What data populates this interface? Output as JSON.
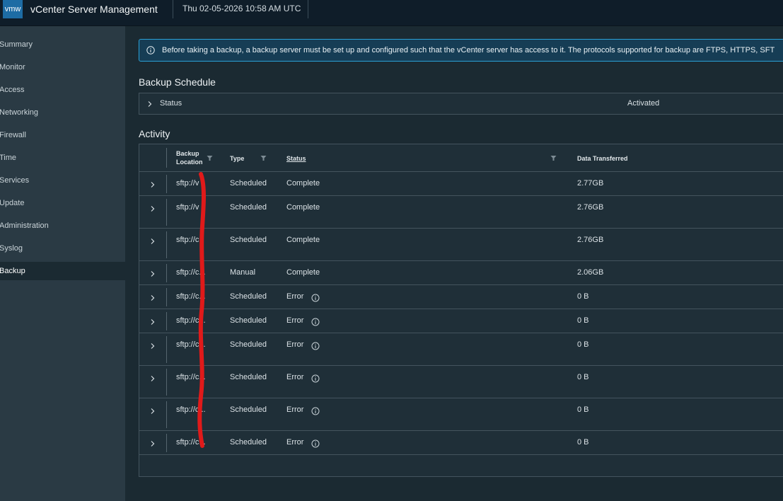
{
  "header": {
    "logo": "vmw",
    "app_title": "vCenter Server Management",
    "datetime": "Thu 02-05-2026 10:58 AM UTC"
  },
  "sidebar": {
    "items": [
      {
        "label": "Summary",
        "active": false
      },
      {
        "label": "Monitor",
        "active": false
      },
      {
        "label": "Access",
        "active": false
      },
      {
        "label": "Networking",
        "active": false
      },
      {
        "label": "Firewall",
        "active": false
      },
      {
        "label": "Time",
        "active": false
      },
      {
        "label": "Services",
        "active": false
      },
      {
        "label": "Update",
        "active": false
      },
      {
        "label": "Administration",
        "active": false
      },
      {
        "label": "Syslog",
        "active": false
      },
      {
        "label": "Backup",
        "active": true
      }
    ]
  },
  "alert": {
    "icon": "info-circle-icon",
    "text": "Before taking a backup, a backup server must be set up and configured such that the vCenter server has access to it. The protocols supported for backup are FTPS, HTTPS, SFT"
  },
  "schedule": {
    "title": "Backup Schedule",
    "status_label": "Status",
    "status_value": "Activated"
  },
  "activity": {
    "title": "Activity",
    "columns": {
      "location_line1": "Backup",
      "location_line2": "Location",
      "type": "Type",
      "status": "Status",
      "data": "Data Transferred"
    },
    "rows": [
      {
        "location": "sftp://v",
        "type": "Scheduled",
        "status": "Complete",
        "data": "2.77GB",
        "error": false
      },
      {
        "location": "sftp://v",
        "type": "Scheduled",
        "status": "Complete",
        "data": "2.76GB",
        "error": false
      },
      {
        "location": "sftp://c",
        "type": "Scheduled",
        "status": "Complete",
        "data": "2.76GB",
        "error": false
      },
      {
        "location": "sftp://c...",
        "type": "Manual",
        "status": "Complete",
        "data": "2.06GB",
        "error": false
      },
      {
        "location": "sftp://c...",
        "type": "Scheduled",
        "status": "Error",
        "data": "0 B",
        "error": true
      },
      {
        "location": "sftp://c...",
        "type": "Scheduled",
        "status": "Error",
        "data": "0 B",
        "error": true
      },
      {
        "location": "sftp://c...",
        "type": "Scheduled",
        "status": "Error",
        "data": "0 B",
        "error": true
      },
      {
        "location": "sftp://c...",
        "type": "Scheduled",
        "status": "Error",
        "data": "0 B",
        "error": true
      },
      {
        "location": "sftp://c...",
        "type": "Scheduled",
        "status": "Error",
        "data": "0 B",
        "error": true
      },
      {
        "location": "sftp://c...",
        "type": "Scheduled",
        "status": "Error",
        "data": "0 B",
        "error": true
      }
    ]
  },
  "colors": {
    "header_bg": "#0f1d29",
    "sidebar_bg": "#2a3a44",
    "main_bg": "#1b2a32",
    "alert_border": "#2aa0d6",
    "redaction": "#e01a1a"
  }
}
